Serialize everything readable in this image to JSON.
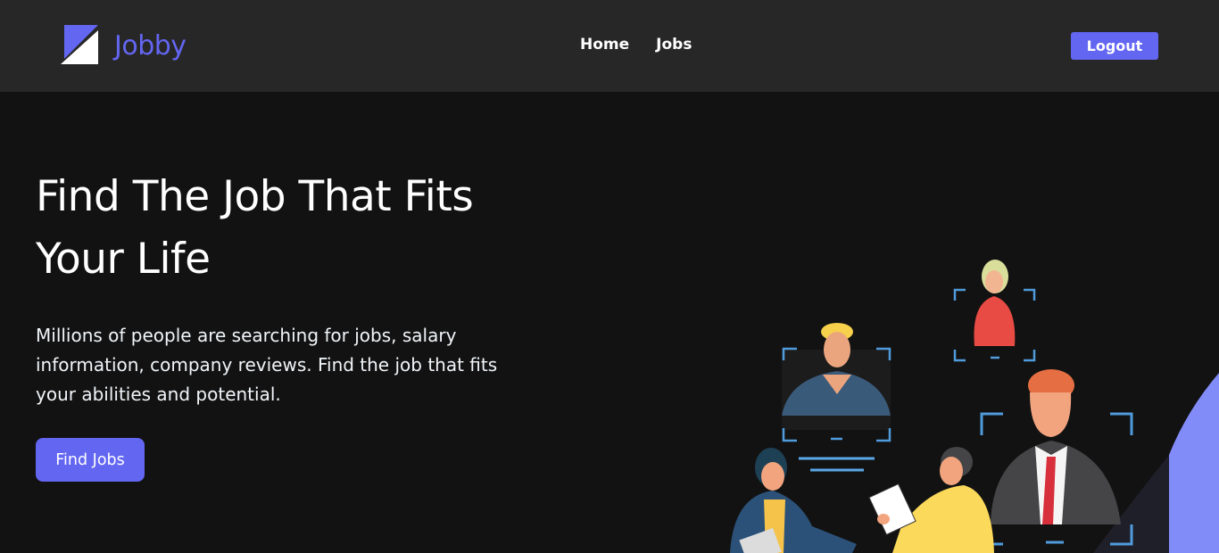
{
  "brand": {
    "name": "Jobby",
    "accent": "#6366f1"
  },
  "nav": {
    "links": [
      {
        "label": "Home"
      },
      {
        "label": "Jobs"
      }
    ],
    "logout_label": "Logout"
  },
  "hero": {
    "heading_line1": "Find The Job That Fits",
    "heading_line2": "Your Life",
    "description": "Millions of people are searching for jobs, salary information, company reviews. Find the job that fits your abilities and potential.",
    "cta_label": "Find Jobs"
  },
  "colors": {
    "navbar_bg": "#272727",
    "page_bg": "#121212",
    "accent": "#6366f1",
    "frame_blue": "#4f9bdc"
  }
}
